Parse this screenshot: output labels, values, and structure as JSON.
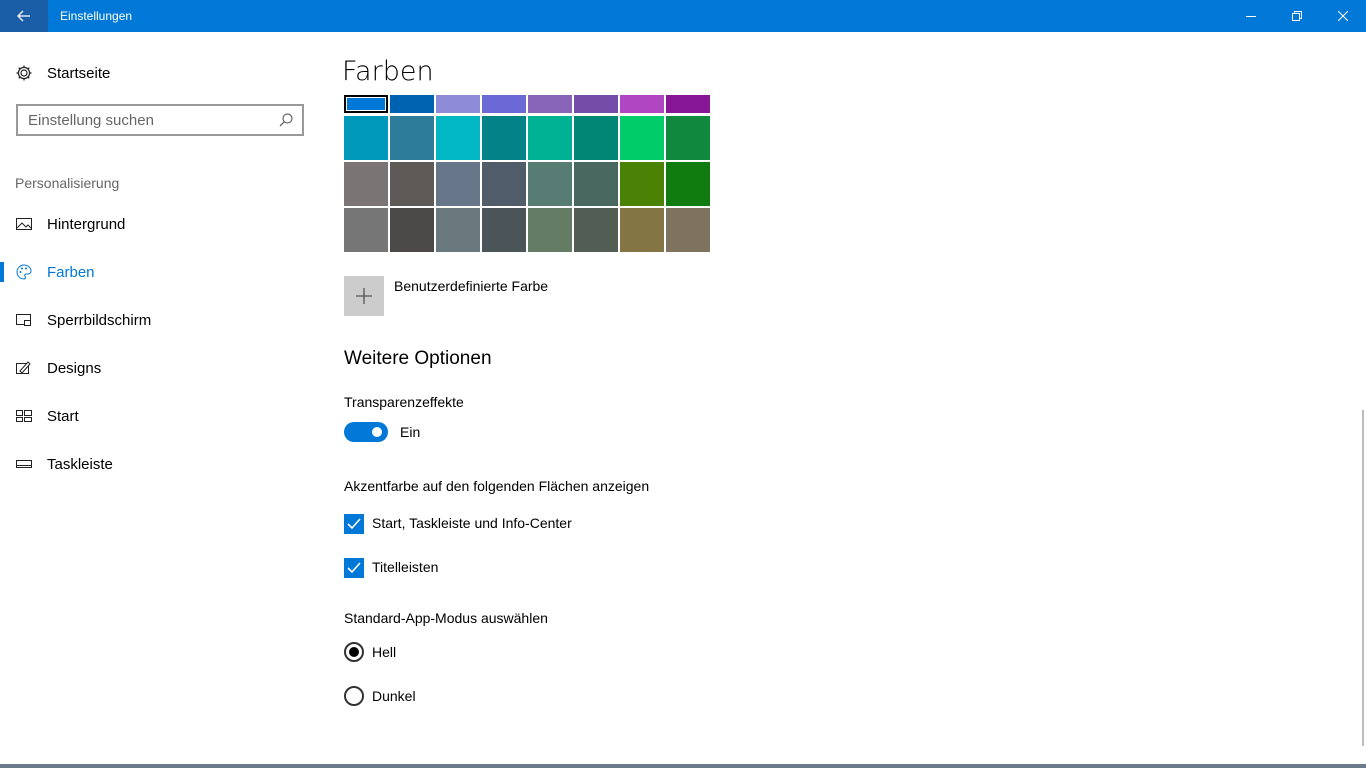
{
  "window": {
    "title": "Einstellungen",
    "back_icon": "arrow-left-icon",
    "accent": "#0078d7"
  },
  "sidebar": {
    "home_label": "Startseite",
    "search_placeholder": "Einstellung suchen",
    "category": "Personalisierung",
    "items": [
      {
        "label": "Hintergrund",
        "icon": "picture-icon",
        "active": false
      },
      {
        "label": "Farben",
        "icon": "palette-icon",
        "active": true
      },
      {
        "label": "Sperrbildschirm",
        "icon": "lock-screen-icon",
        "active": false
      },
      {
        "label": "Designs",
        "icon": "designs-icon",
        "active": false
      },
      {
        "label": "Start",
        "icon": "start-tiles-icon",
        "active": false
      },
      {
        "label": "Taskleiste",
        "icon": "taskbar-icon",
        "active": false
      }
    ]
  },
  "main": {
    "title": "Farben",
    "swatches": [
      [
        "#0078d7",
        "#0063b1",
        "#8e8cd8",
        "#6b69d6",
        "#8764b8",
        "#744da9",
        "#b146c2",
        "#881798"
      ],
      [
        "#0099bc",
        "#2d7d9a",
        "#00b7c3",
        "#038387",
        "#00b294",
        "#018574",
        "#00cc6a",
        "#10893e"
      ],
      [
        "#7a7574",
        "#5d5a58",
        "#68768a",
        "#515c6b",
        "#567c73",
        "#486860",
        "#498205",
        "#107c10"
      ],
      [
        "#767676",
        "#4c4a48",
        "#69797e",
        "#4a5459",
        "#647c64",
        "#525e54",
        "#847545",
        "#7e735f"
      ]
    ],
    "custom_color_label": "Benutzerdefinierte Farbe",
    "more_options_title": "Weitere Optionen",
    "transparency": {
      "label": "Transparenzeffekte",
      "state_label": "Ein",
      "on": true
    },
    "accent_surfaces": {
      "label": "Akzentfarbe auf den folgenden Flächen anzeigen",
      "options": [
        {
          "label": "Start, Taskleiste und Info-Center",
          "checked": true
        },
        {
          "label": "Titelleisten",
          "checked": true
        }
      ]
    },
    "app_mode": {
      "label": "Standard-App-Modus auswählen",
      "options": [
        {
          "label": "Hell",
          "selected": true
        },
        {
          "label": "Dunkel",
          "selected": false
        }
      ]
    }
  }
}
